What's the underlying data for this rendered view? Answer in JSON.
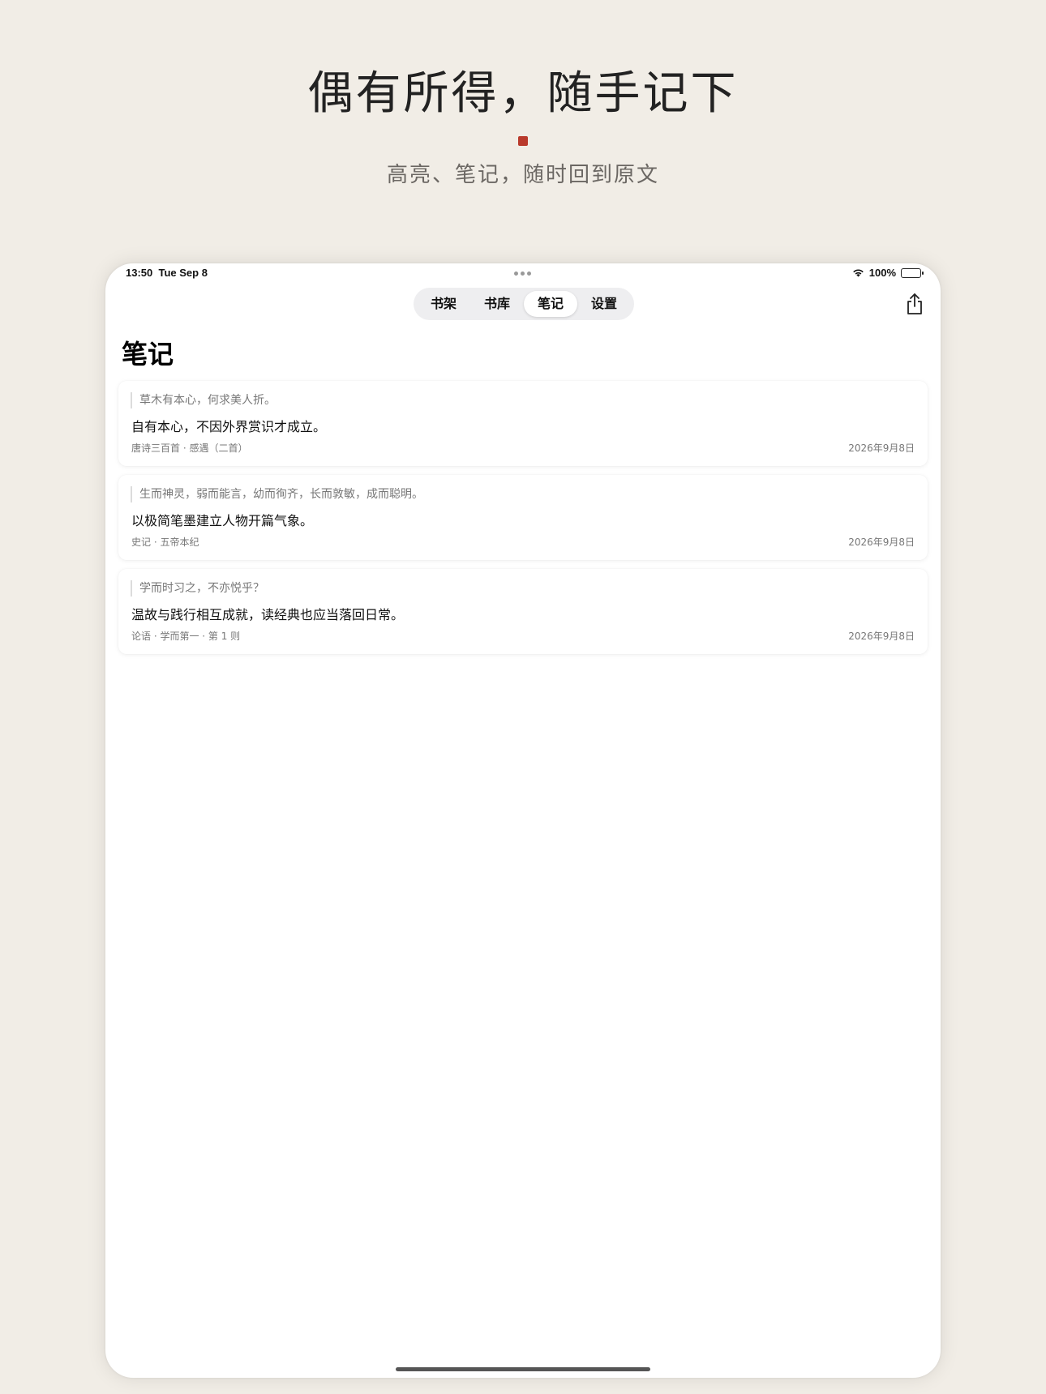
{
  "hero": {
    "title": "偶有所得，随手记下",
    "subtitle": "高亮、笔记，随时回到原文",
    "accent_color": "#b93a2c"
  },
  "status_bar": {
    "time": "13:50",
    "date": "Tue Sep 8",
    "battery": "100%",
    "icons": [
      "wifi-icon",
      "battery-icon"
    ]
  },
  "tabs": [
    {
      "label": "书架",
      "active": false
    },
    {
      "label": "书库",
      "active": false
    },
    {
      "label": "笔记",
      "active": true
    },
    {
      "label": "设置",
      "active": false
    }
  ],
  "toolbar": {
    "share_icon": "share-icon"
  },
  "page": {
    "title": "笔记"
  },
  "notes": [
    {
      "quote": "草木有本心，何求美人折。",
      "note": "自有本心，不因外界赏识才成立。",
      "source": "唐诗三百首 · 感遇（二首）",
      "date": "2026年9月8日"
    },
    {
      "quote": "生而神灵，弱而能言，幼而徇齐，长而敦敏，成而聪明。",
      "note": "以极简笔墨建立人物开篇气象。",
      "source": "史记 · 五帝本纪",
      "date": "2026年9月8日"
    },
    {
      "quote": "学而时习之，不亦悦乎？",
      "note": "温故与践行相互成就，读经典也应当落回日常。",
      "source": "论语 · 学而第一 · 第 1 则",
      "date": "2026年9月8日"
    }
  ]
}
